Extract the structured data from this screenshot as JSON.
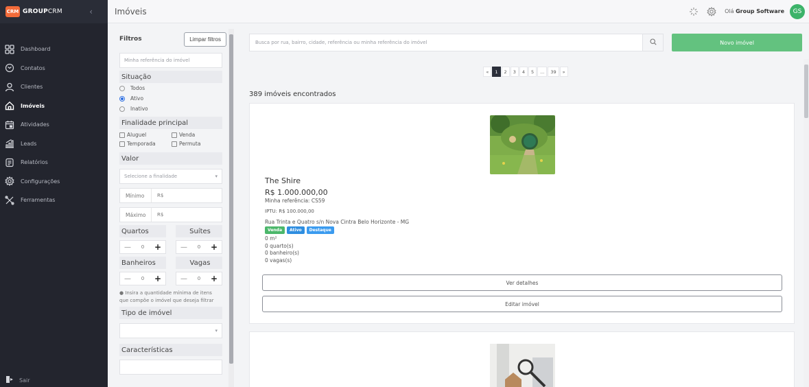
{
  "brand": {
    "logo": "CRM",
    "name_bold": "GROUP",
    "name_light": "CRM"
  },
  "sidebar": {
    "items": [
      {
        "label": "Dashboard",
        "icon": "dashboard-icon"
      },
      {
        "label": "Contatos",
        "icon": "contacts-icon"
      },
      {
        "label": "Clientes",
        "icon": "user-icon"
      },
      {
        "label": "Imóveis",
        "icon": "home-icon",
        "active": true
      },
      {
        "label": "Atividades",
        "icon": "calendar-icon"
      },
      {
        "label": "Leads",
        "icon": "leads-icon"
      },
      {
        "label": "Relatórios",
        "icon": "report-icon"
      },
      {
        "label": "Configurações",
        "icon": "gear-icon"
      },
      {
        "label": "Ferramentas",
        "icon": "tools-icon"
      }
    ],
    "logout": "Sair"
  },
  "topbar": {
    "title": "Imóveis",
    "greeting": "Olá",
    "user": "Group Software",
    "initials": "GS"
  },
  "filters": {
    "title": "Filtros",
    "clear": "Limpar filtros",
    "ref_placeholder": "Minha referência do imóvel",
    "situation": {
      "title": "Situação",
      "options": [
        "Todos",
        "Ativo",
        "Inativo"
      ],
      "selected": "Ativo"
    },
    "purpose": {
      "title": "Finalidade principal",
      "options": [
        "Aluguel",
        "Venda",
        "Temporada",
        "Permuta"
      ]
    },
    "value": {
      "title": "Valor",
      "select_placeholder": "Selecione a finalidade",
      "min": "Mínimo",
      "max": "Máximo",
      "currency": "R$"
    },
    "rooms": {
      "label": "Quartos",
      "value": "0"
    },
    "suites": {
      "label": "Suítes",
      "value": "0"
    },
    "baths": {
      "label": "Banheiros",
      "value": "0"
    },
    "parking": {
      "label": "Vagas",
      "value": "0"
    },
    "hint": "Insira a quantidade mínima de itens que compõe o imóvel que deseja filtrar",
    "type_title": "Tipo de imóvel",
    "features_title": "Características"
  },
  "main": {
    "search_placeholder": "Busca por rua, bairro, cidade, referência ou minha referência do imóvel",
    "new_button": "Novo imóvel",
    "pagination": [
      "«",
      "1",
      "2",
      "3",
      "4",
      "5",
      "...",
      "39",
      "»"
    ],
    "current_page": "1",
    "count": "389 imóveis encontrados"
  },
  "listing": {
    "name": "The Shire",
    "price": "R$ 1.000.000,00",
    "ref": "Minha referência: CS59",
    "iptu": "IPTU: R$ 100.000,00",
    "address": "Rua Trinta e Quatro s/n Nova Cintra Belo Horizonte - MG",
    "badges": [
      {
        "label": "Venda",
        "color": "#4cb76b"
      },
      {
        "label": "Ativo",
        "color": "#2f8ee0"
      },
      {
        "label": "Destaque",
        "color": "#3b9bef"
      }
    ],
    "area": "0 m²",
    "bedrooms": "0 quarto(s)",
    "bathrooms": "0 banheiro(s)",
    "parking": "0 vagas(s)",
    "details": "Ver detalhes",
    "edit": "Editar imóvel"
  },
  "colors": {
    "sidebar": "#23252e",
    "accent": "#63c27f",
    "brand": "#f26b3a"
  }
}
